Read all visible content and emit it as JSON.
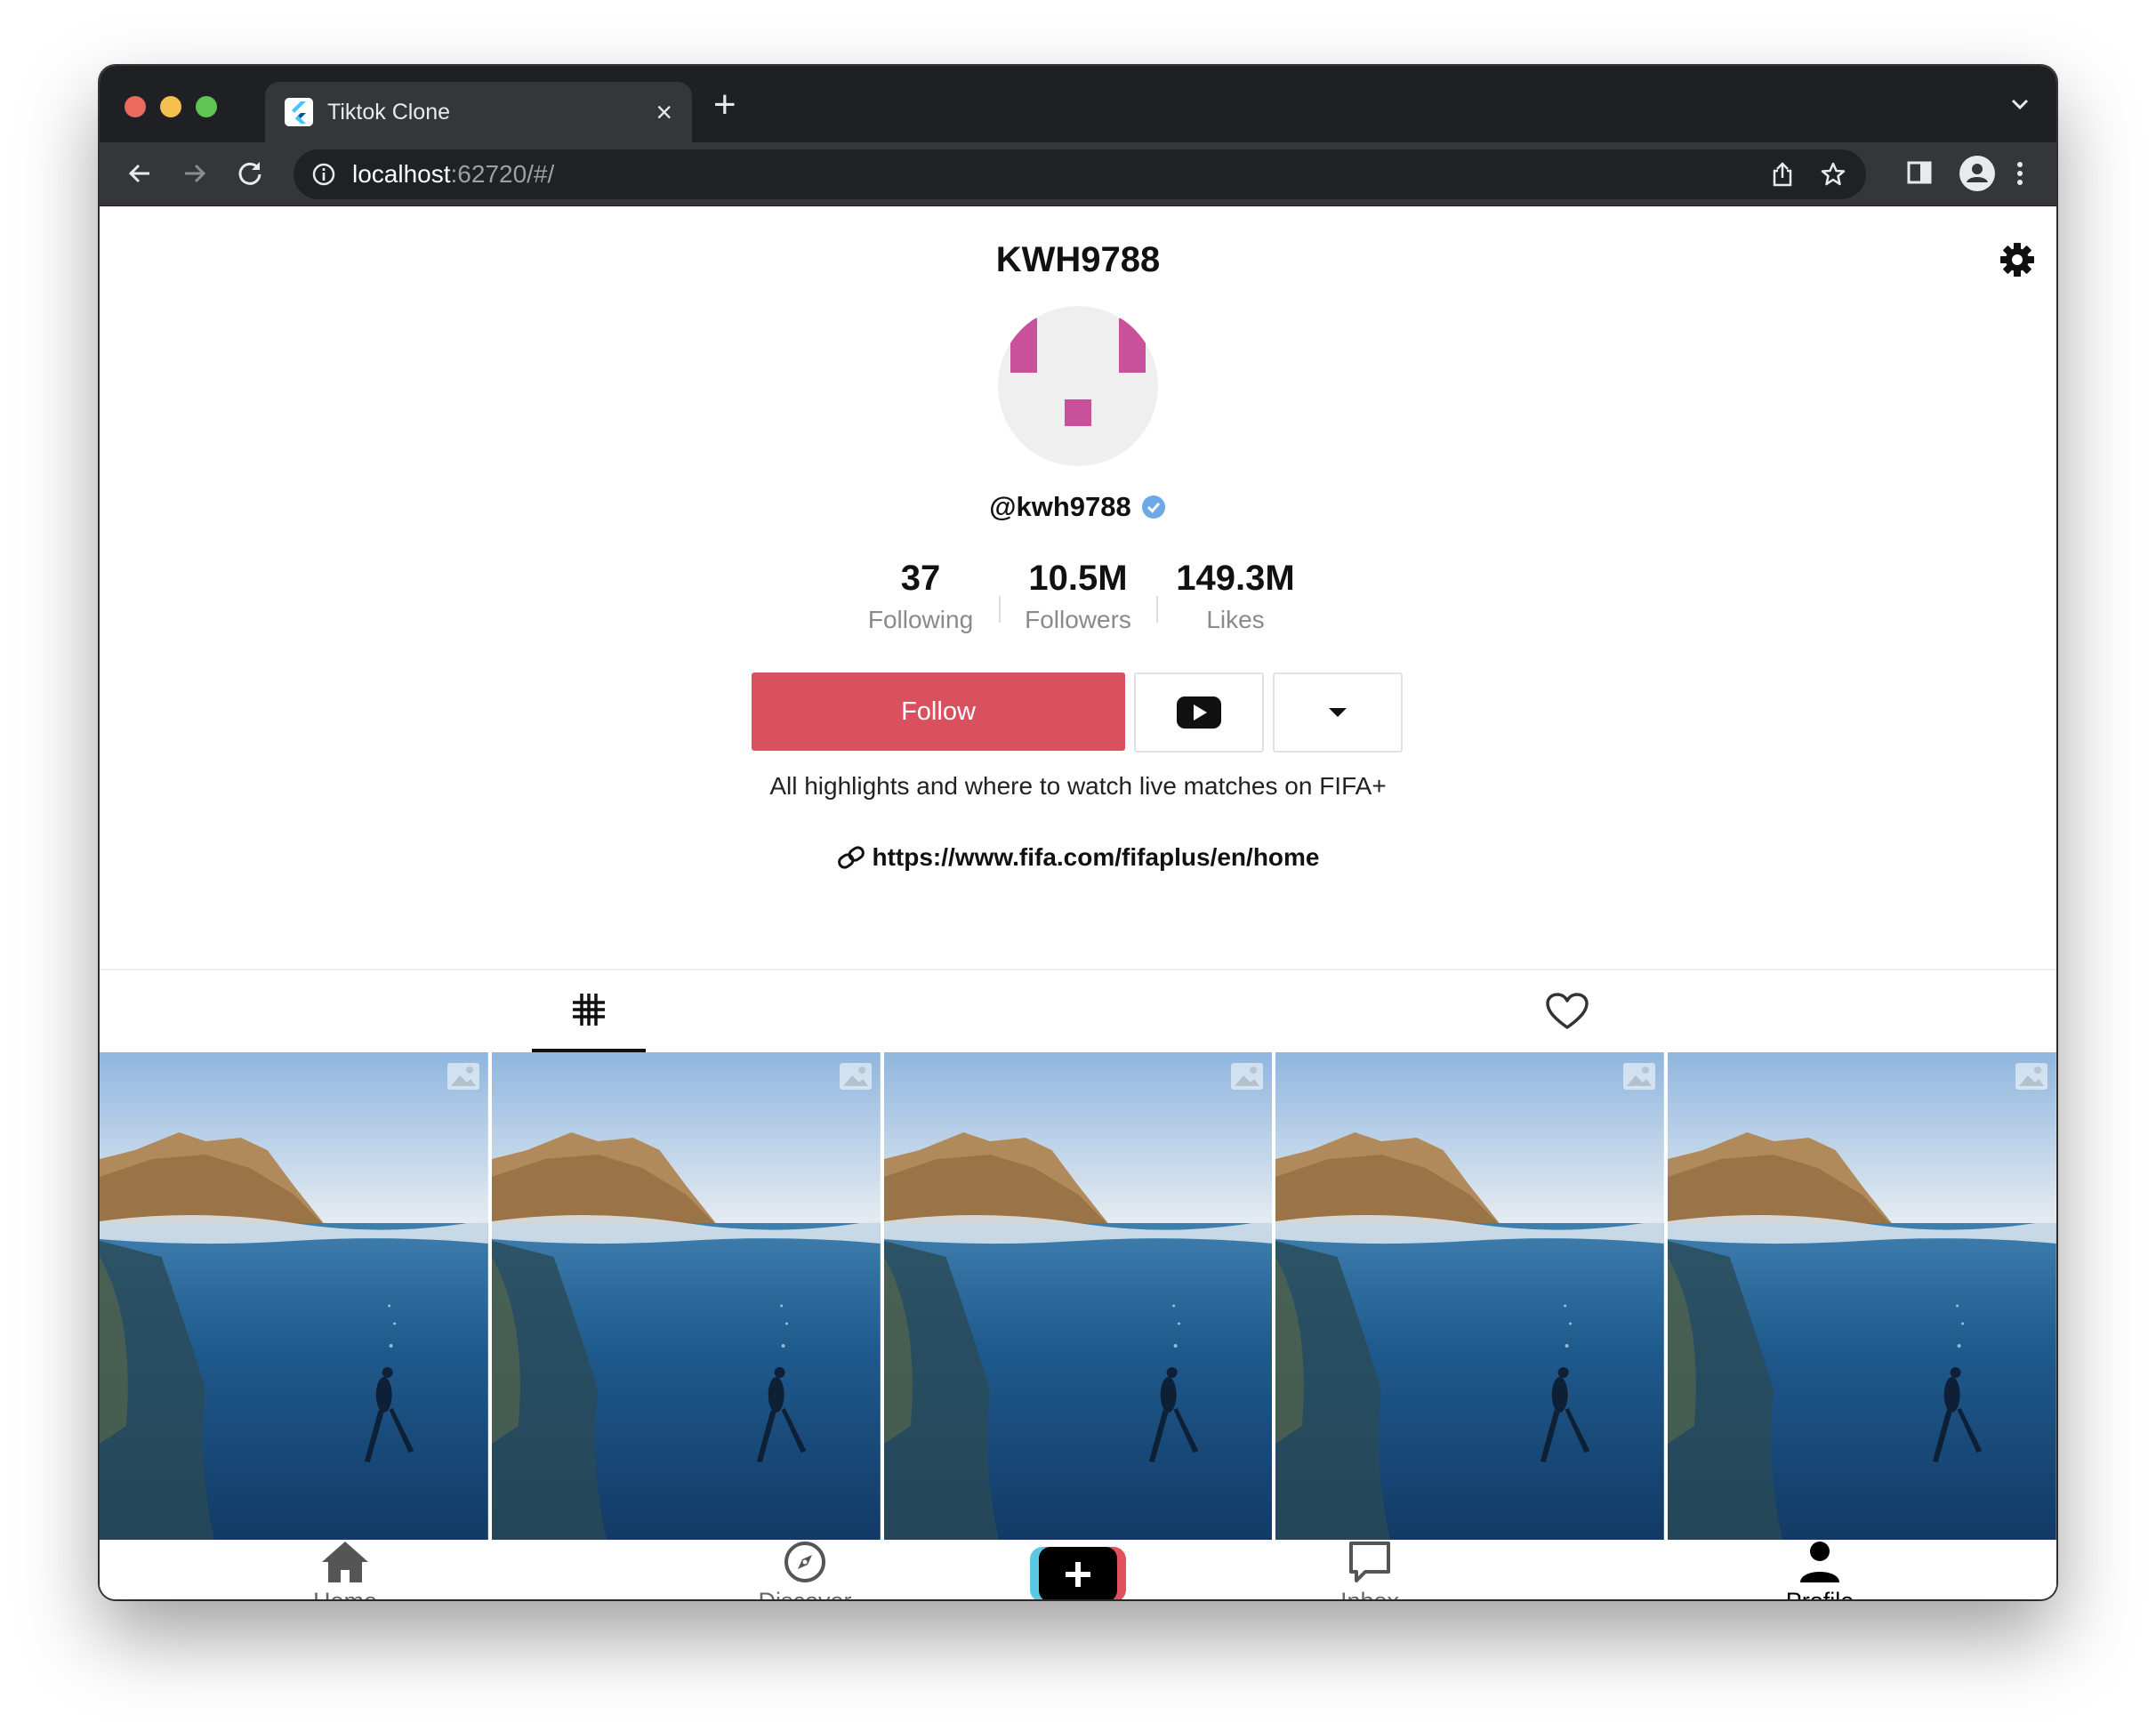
{
  "browser": {
    "tab_title": "Tiktok Clone",
    "url_host": "localhost",
    "url_rest": ":62720/#/"
  },
  "profile": {
    "title": "KWH9788",
    "handle": "@kwh9788",
    "stats": [
      {
        "value": "37",
        "label": "Following"
      },
      {
        "value": "10.5M",
        "label": "Followers"
      },
      {
        "value": "149.3M",
        "label": "Likes"
      }
    ],
    "follow_label": "Follow",
    "bio": "All highlights and where to watch live matches on FIFA+",
    "link": "https://www.fifa.com/fifaplus/en/home"
  },
  "nav": {
    "home": "Home",
    "discover": "Discover",
    "inbox": "Inbox",
    "profile": "Profile"
  },
  "colors": {
    "follow": "#d9505e",
    "verified": "#6fa8e8",
    "avatar_accent": "#c9509a"
  }
}
